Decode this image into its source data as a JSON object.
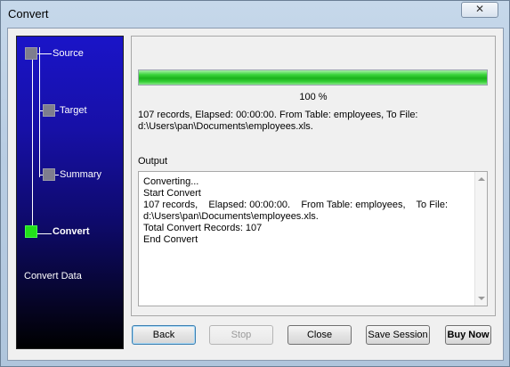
{
  "window": {
    "title": "Convert",
    "close_glyph": "✕"
  },
  "sidebar": {
    "steps": [
      {
        "label": "Source",
        "active": false
      },
      {
        "label": "Target",
        "active": false
      },
      {
        "label": "Summary",
        "active": false
      },
      {
        "label": "Convert",
        "active": true
      }
    ],
    "caption": "Convert Data"
  },
  "progress": {
    "percent": 100,
    "percent_label": "100 %",
    "fill_color": "#1bb31b"
  },
  "status": {
    "text": "107 records,    Elapsed: 00:00:00.    From Table: employees,    To File: d:\\Users\\pan\\Documents\\employees.xls."
  },
  "output": {
    "label": "Output",
    "text": "Converting...\nStart Convert\n107 records,    Elapsed: 00:00:00.    From Table: employees,    To File: d:\\Users\\pan\\Documents\\employees.xls.\nTotal Convert Records: 107\nEnd Convert"
  },
  "buttons": {
    "back": "Back",
    "stop": "Stop",
    "close": "Close",
    "save_session": "Save Session",
    "buy_now": "Buy Now"
  },
  "icons": {
    "close": "close-icon",
    "scroll_up": "scroll-up-icon",
    "scroll_down": "scroll-down-icon"
  }
}
